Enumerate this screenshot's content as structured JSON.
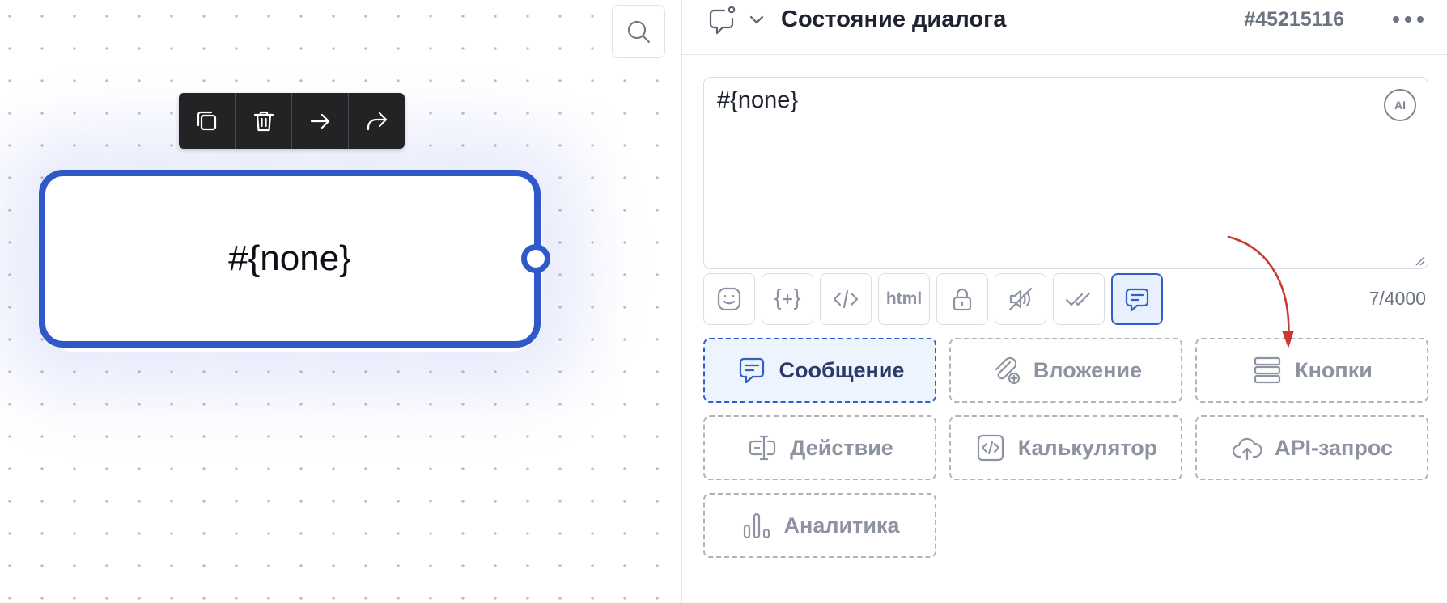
{
  "canvas": {
    "node": {
      "title": "#{none}"
    },
    "node_toolbar": {
      "icons": [
        "copy-icon",
        "trash-icon",
        "arrow-right-icon",
        "share-icon"
      ]
    },
    "search_icon": "search-icon"
  },
  "header": {
    "title": "Состояние диалога",
    "id": "#45215116"
  },
  "editor": {
    "text": "#{none}",
    "ai_label": "AI",
    "char_count": "7/4000"
  },
  "format_toolbar": {
    "html_label": "html",
    "buttons": [
      "emoji-icon",
      "variable-icon",
      "code-icon",
      "html",
      "lock-icon",
      "voice-off-icon",
      "double-check-icon",
      "message-icon"
    ],
    "active": "message-icon"
  },
  "blocks": {
    "message": "Сообщение",
    "attachment": "Вложение",
    "buttons": "Кнопки",
    "action": "Действие",
    "calculator": "Калькулятор",
    "api": "API-запрос",
    "analytics": "Аналитика"
  },
  "colors": {
    "accent": "#2f58c8",
    "active_bg": "#edf4fe",
    "annotation_arrow": "#c83a2e"
  }
}
